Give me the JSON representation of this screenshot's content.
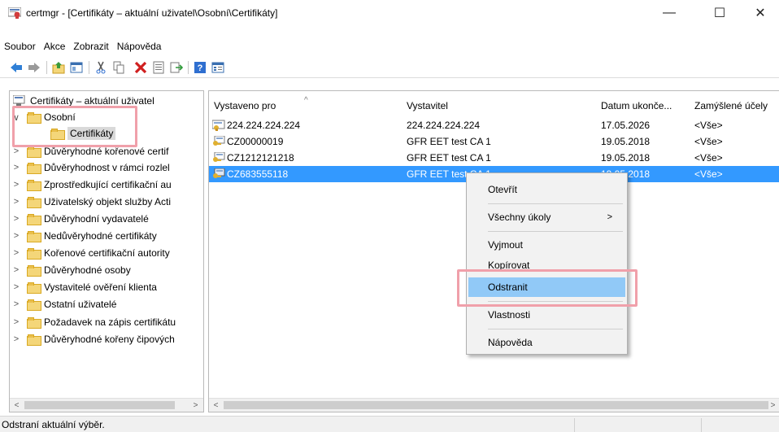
{
  "window": {
    "title": "certmgr - [Certifikáty – aktuální uživatel\\Osobní\\Certifikáty]",
    "min_glyph": "—",
    "max_glyph": "☐",
    "close_glyph": "✕"
  },
  "menu": [
    "Soubor",
    "Akce",
    "Zobrazit",
    "Nápověda"
  ],
  "toolbar": {
    "icons": [
      "back-icon",
      "forward-icon",
      "up-folder-icon",
      "show-hide-tree-icon",
      "cut-icon",
      "copy-icon",
      "delete-icon",
      "properties-icon",
      "export-icon",
      "help-icon",
      "view-icon"
    ]
  },
  "tree": {
    "root": "Certifikáty – aktuální uživatel",
    "items": [
      {
        "label": "Osobní",
        "expander": "∨"
      },
      {
        "label": "Certifikáty",
        "expander": ""
      },
      {
        "label": "Důvěryhodné kořenové certif",
        "expander": ">"
      },
      {
        "label": "Důvěryhodnost v rámci rozlel",
        "expander": ">"
      },
      {
        "label": "Zprostředkující certifikační au",
        "expander": ">"
      },
      {
        "label": "Uživatelský objekt služby Acti",
        "expander": ">"
      },
      {
        "label": "Důvěryhodní vydavatelé",
        "expander": ">"
      },
      {
        "label": "Nedůvěryhodné certifikáty",
        "expander": ">"
      },
      {
        "label": "Kořenové certifikační autority",
        "expander": ">"
      },
      {
        "label": "Důvěryhodné osoby",
        "expander": ">"
      },
      {
        "label": "Vystavitelé ověření klienta",
        "expander": ">"
      },
      {
        "label": "Ostatní uživatelé",
        "expander": ">"
      },
      {
        "label": "Požadavek na zápis certifikátu",
        "expander": ">"
      },
      {
        "label": "Důvěryhodné kořeny čipových",
        "expander": ">"
      }
    ]
  },
  "list": {
    "columns": [
      "Vystaveno pro",
      "Vystavitel",
      "Datum ukonče...",
      "Zamýšlené účely"
    ],
    "sort_glyph": "^",
    "rows": [
      {
        "issued_to": "224.224.224.224",
        "issuer": "224.224.224.224",
        "expires": "17.05.2026",
        "purposes": "<Vše>"
      },
      {
        "issued_to": "CZ00000019",
        "issuer": "GFR EET test CA 1",
        "expires": "19.05.2018",
        "purposes": "<Vše>"
      },
      {
        "issued_to": "CZ1212121218",
        "issuer": "GFR EET test CA 1",
        "expires": "19.05.2018",
        "purposes": "<Vše>"
      },
      {
        "issued_to": "CZ683555118",
        "issuer": "GFR EET test CA 1",
        "expires": "19.05.2018",
        "purposes": "<Vše>"
      }
    ],
    "selected_index": 3
  },
  "context_menu": {
    "items": [
      "Otevřít",
      "Všechny úkoly",
      "Vyjmout",
      "Kopírovat",
      "Odstranit",
      "Vlastnosti",
      "Nápověda"
    ],
    "submenu_glyph": ">",
    "highlighted": "Odstranit"
  },
  "scroll": {
    "left_glyph": "<",
    "right_glyph": ">"
  },
  "status": {
    "text": "Odstraní aktuální výběr."
  },
  "colors": {
    "selection": "#3399ff",
    "menu_hover": "#91c9f7",
    "highlight_box": "#f0a0aa"
  }
}
